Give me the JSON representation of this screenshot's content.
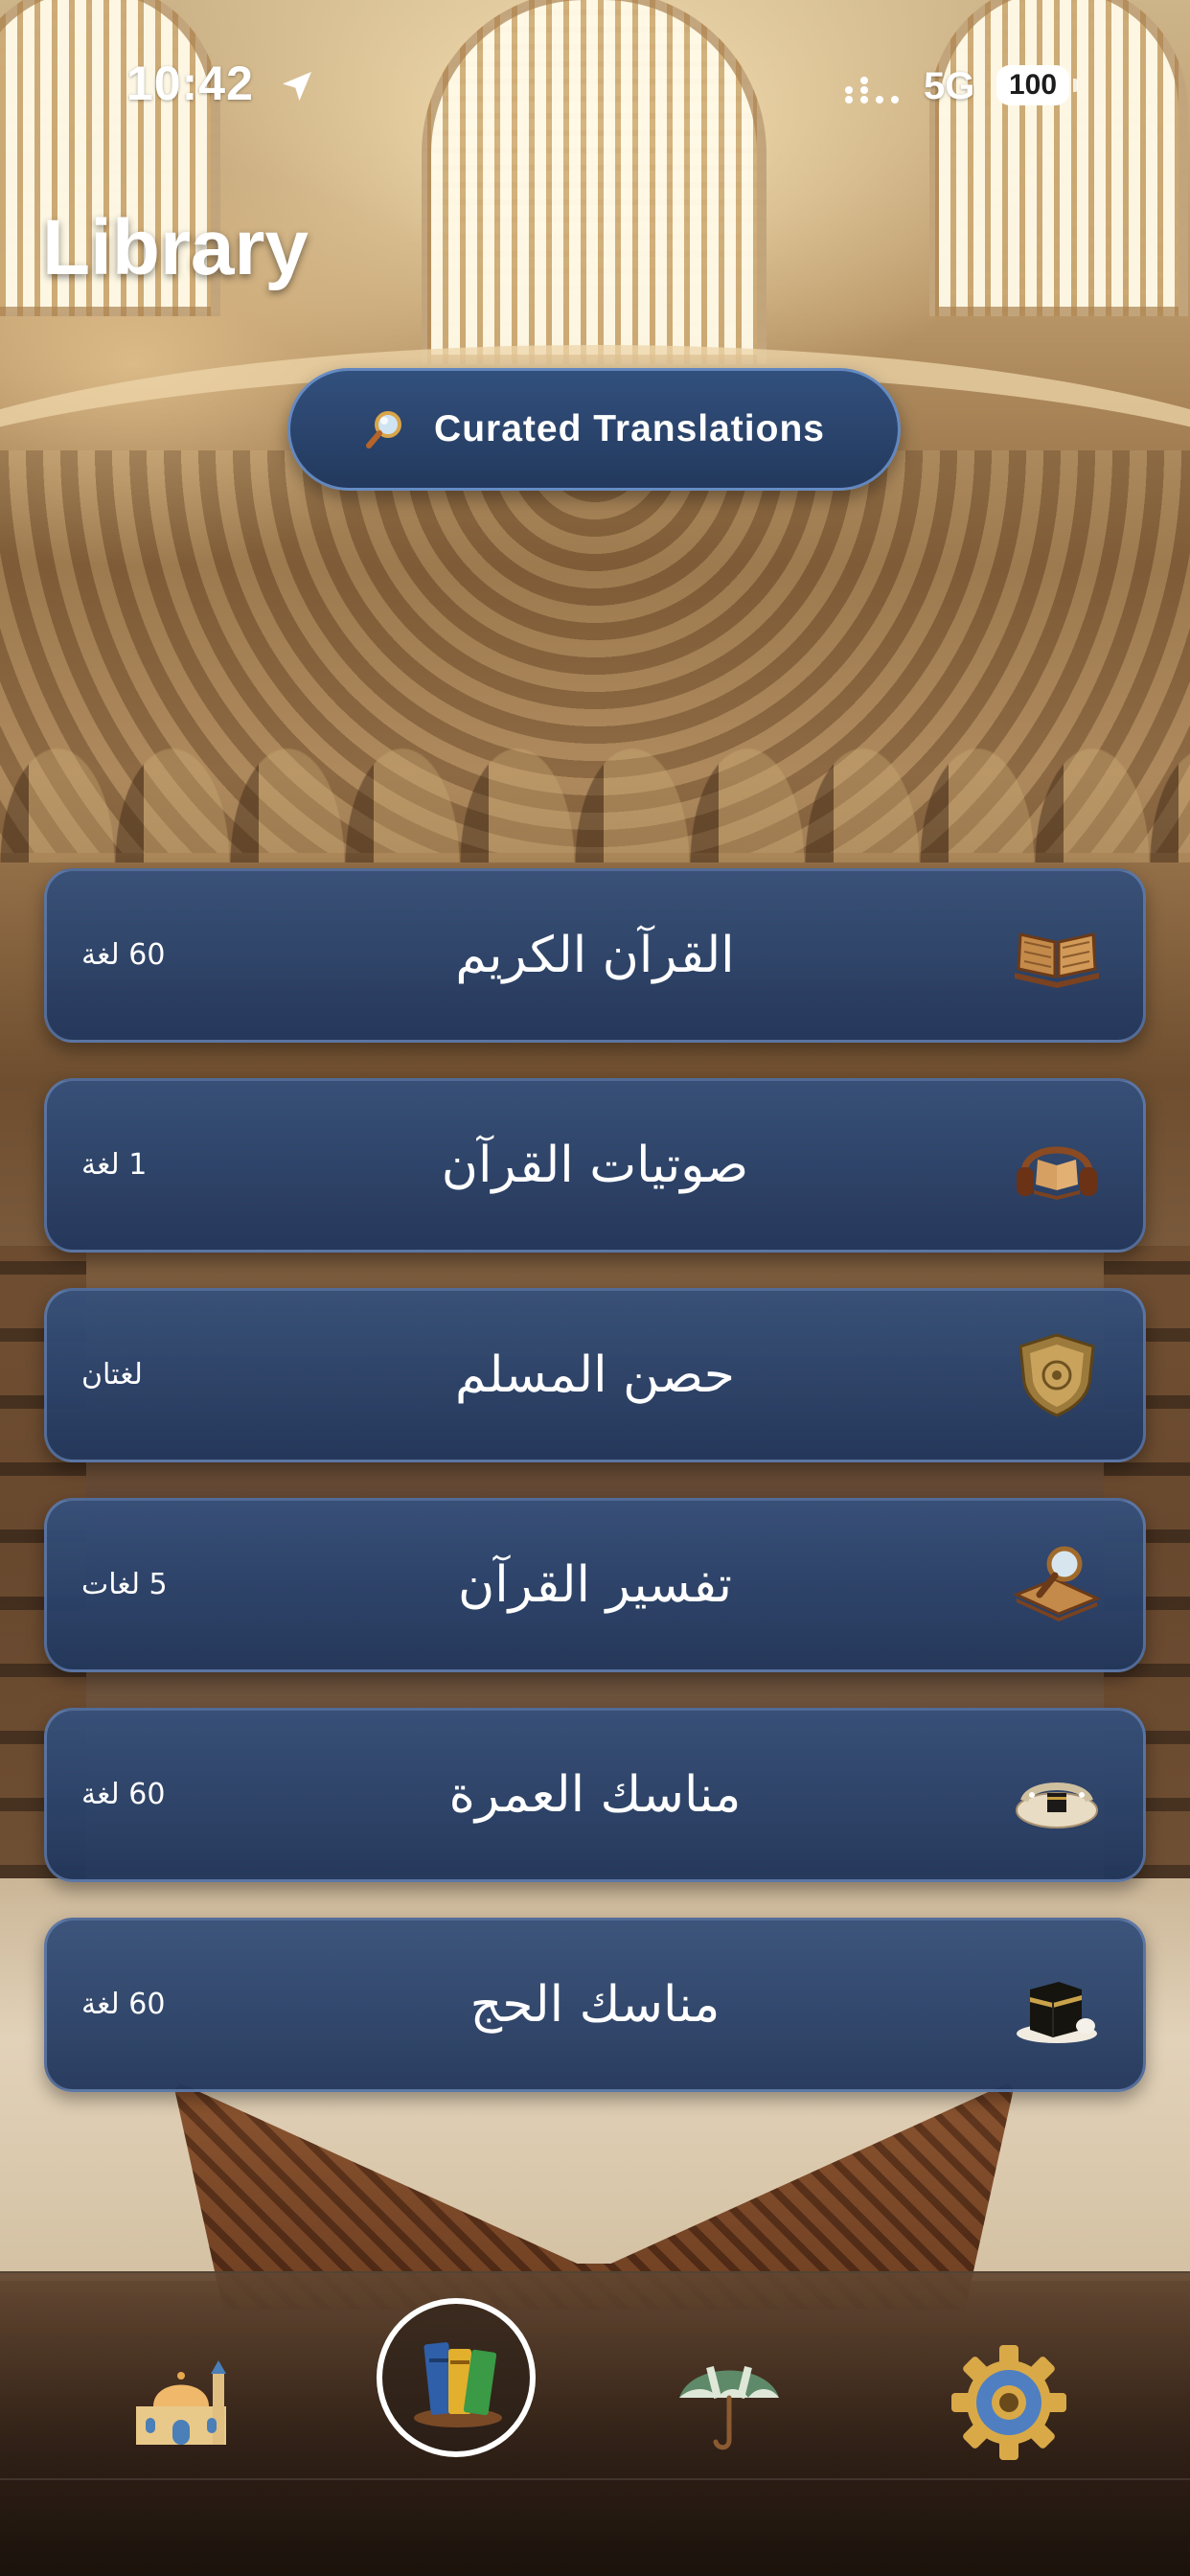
{
  "status_bar": {
    "time": "10:42",
    "network": "5G",
    "battery": "100",
    "location_icon": "location-arrow-icon",
    "signal_icon": "signal-dots-icon"
  },
  "header": {
    "title": "Library"
  },
  "curated": {
    "label": "Curated Translations",
    "icon": "magnifier-icon"
  },
  "library_items": [
    {
      "title": "القرآن الكريم",
      "count": "60 لغة",
      "icon": "open-book-icon"
    },
    {
      "title": "صوتيات القرآن",
      "count": "1 لغة",
      "icon": "headphones-book-icon"
    },
    {
      "title": "حصن المسلم",
      "count": "لغتان",
      "icon": "shield-icon"
    },
    {
      "title": "تفسير القرآن",
      "count": "5 لغات",
      "icon": "magnifier-book-icon"
    },
    {
      "title": "مناسك العمرة",
      "count": "60 لغة",
      "icon": "kaaba-scene-icon"
    },
    {
      "title": "مناسك الحج",
      "count": "60 لغة",
      "icon": "kaaba-icon"
    }
  ],
  "tab_bar": {
    "tabs": [
      {
        "name": "mosque",
        "icon": "mosque-icon",
        "active": false
      },
      {
        "name": "library",
        "icon": "books-icon",
        "active": true
      },
      {
        "name": "umbrella",
        "icon": "umbrella-icon",
        "active": false
      },
      {
        "name": "settings",
        "icon": "gear-icon",
        "active": false
      }
    ]
  },
  "colors": {
    "card_bg": "#2a4068",
    "card_border": "#7896c8",
    "accent_border": "#ffffff",
    "text": "#ffffff"
  }
}
